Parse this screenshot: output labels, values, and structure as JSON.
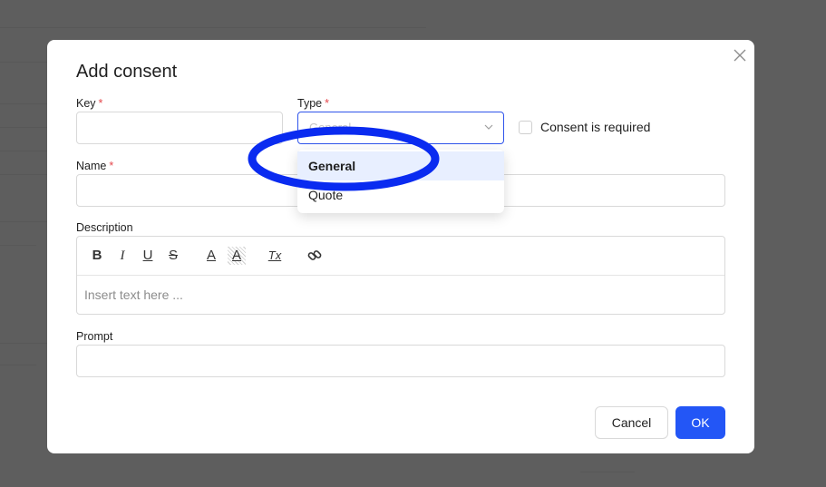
{
  "modal": {
    "title": "Add consent",
    "close_icon": "close-icon"
  },
  "form": {
    "key": {
      "label": "Key",
      "required_mark": "*",
      "value": ""
    },
    "type": {
      "label": "Type",
      "required_mark": "*",
      "placeholder": "General",
      "options": [
        "General",
        "Quote"
      ],
      "highlighted_option": "General"
    },
    "consent_required": {
      "label": "Consent is required",
      "checked": false
    },
    "name": {
      "label": "Name",
      "required_mark": "*",
      "value": ""
    },
    "description": {
      "label": "Description",
      "placeholder": "Insert text here ...",
      "toolbar": [
        {
          "name": "bold-icon",
          "glyph": "B"
        },
        {
          "name": "italic-icon",
          "glyph": "I"
        },
        {
          "name": "underline-icon",
          "glyph": "U"
        },
        {
          "name": "strikethrough-icon",
          "glyph": "S"
        },
        {
          "name": "font-color-icon",
          "glyph": "A"
        },
        {
          "name": "highlight-color-icon",
          "glyph": "A"
        },
        {
          "name": "clear-format-icon",
          "glyph": "Tx"
        },
        {
          "name": "link-icon",
          "glyph": "🔗"
        }
      ]
    },
    "prompt": {
      "label": "Prompt",
      "value": ""
    }
  },
  "footer": {
    "cancel_label": "Cancel",
    "ok_label": "OK"
  },
  "colors": {
    "primary": "#2356f6",
    "required": "#e5484d",
    "annotation": "#0a2bf0",
    "overlay": "#5e5e5e"
  }
}
